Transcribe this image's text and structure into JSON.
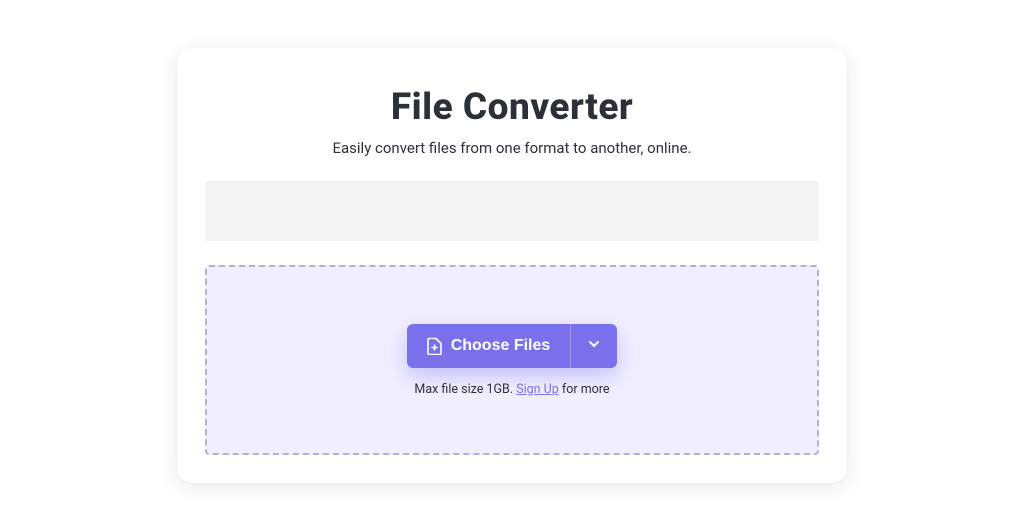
{
  "header": {
    "title": "File Converter",
    "subtitle": "Easily convert files from one format to another, online."
  },
  "dropzone": {
    "choose_files_label": "Choose Files",
    "hint_prefix": "Max file size 1GB. ",
    "hint_link": "Sign Up",
    "hint_suffix": " for more"
  },
  "colors": {
    "accent": "#7a70eb",
    "dropzone_bg": "#f1efff",
    "dropzone_border": "#b3b0d6",
    "text": "#2c3038"
  }
}
